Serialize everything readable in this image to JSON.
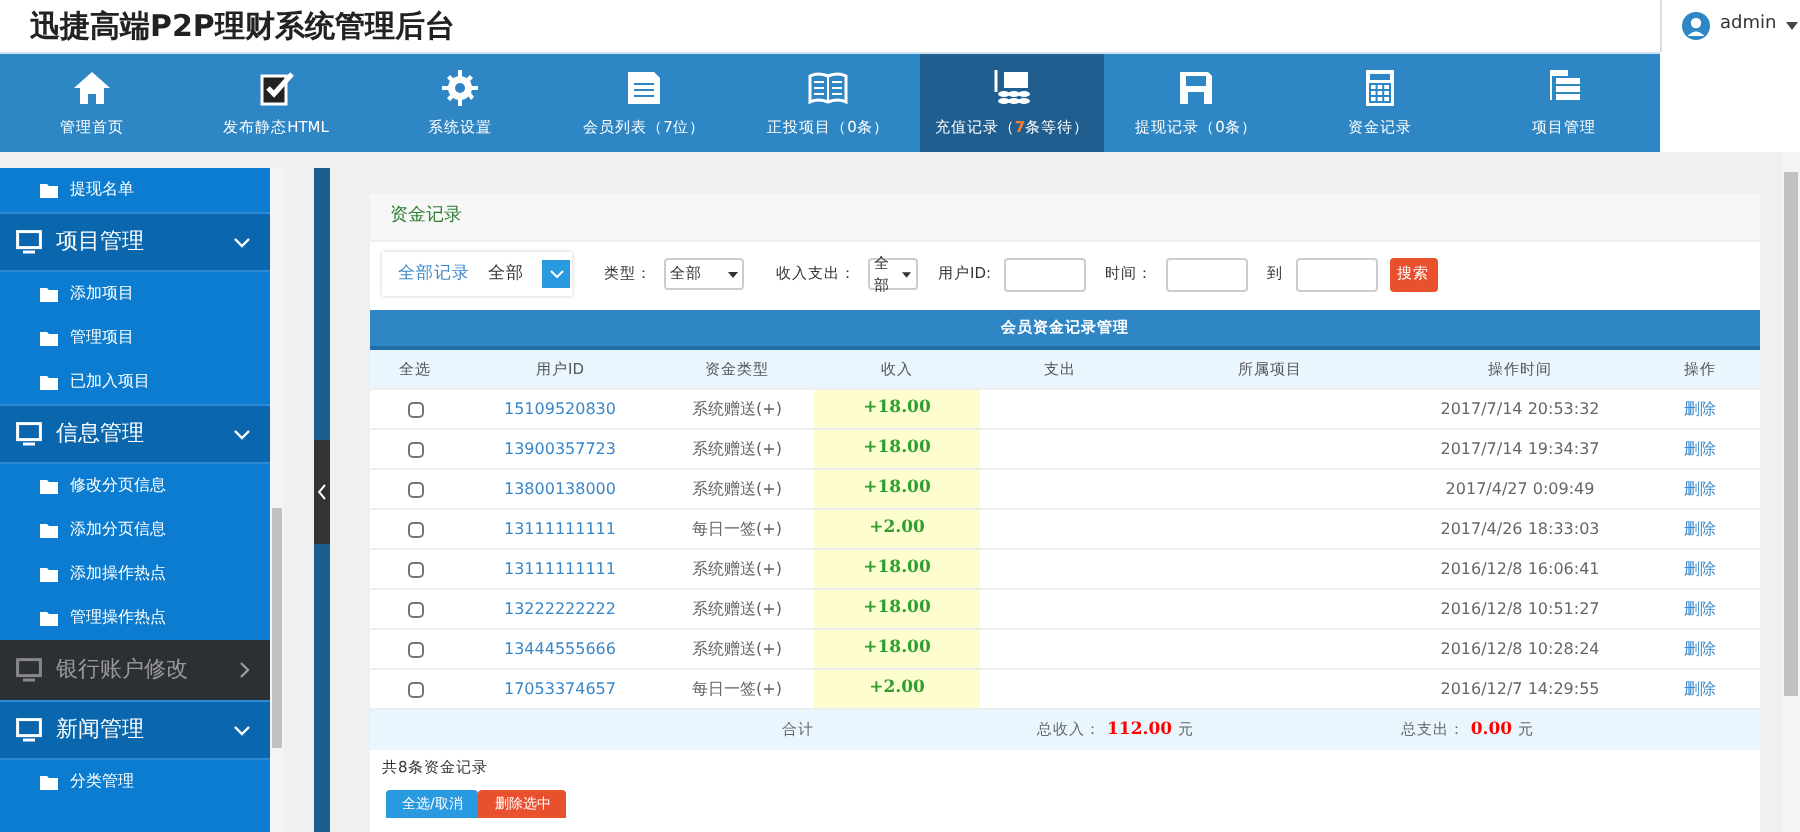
{
  "header": {
    "title": "迅捷高端P2P理财系统管理后台",
    "user": "admin"
  },
  "nav": [
    {
      "label": "管理首页",
      "selected": false
    },
    {
      "label": "发布静态HTML",
      "selected": false
    },
    {
      "label": "系统设置",
      "selected": false
    },
    {
      "label": "会员列表（7位）",
      "selected": false
    },
    {
      "label": "正投项目（0条）",
      "selected": false
    },
    {
      "label": "充值记录（",
      "count": "7",
      "suffix": "条等待）",
      "selected": true
    },
    {
      "label": "提现记录（0条）",
      "selected": false
    },
    {
      "label": "资金记录",
      "selected": false
    },
    {
      "label": "项目管理",
      "selected": false
    }
  ],
  "sidebar": [
    {
      "kind": "item",
      "label": "提现名单"
    },
    {
      "kind": "group",
      "label": "项目管理",
      "expanded": true,
      "children": [
        "添加项目",
        "管理项目",
        "已加入项目"
      ]
    },
    {
      "kind": "group",
      "label": "信息管理",
      "expanded": true,
      "children": [
        "修改分页信息",
        "添加分页信息",
        "添加操作热点",
        "管理操作热点"
      ]
    },
    {
      "kind": "group",
      "label": "银行账户修改",
      "expanded": false
    },
    {
      "kind": "group",
      "label": "新闻管理",
      "expanded": true,
      "children": [
        "分类管理"
      ]
    }
  ],
  "panel": {
    "title": "资金记录",
    "filter": {
      "scope_link": "全部记录",
      "scope_value": "全部",
      "type_label": "类型：",
      "type_value": "全部",
      "io_label": "收入支出：",
      "io_value": "全部",
      "user_label": "用户ID:",
      "time_label": "时间：",
      "to_label": "到",
      "search": "搜索"
    },
    "table": {
      "caption": "会员资金记录管理",
      "columns": [
        "全选",
        "用户ID",
        "资金类型",
        "收入",
        "支出",
        "所属项目",
        "操作时间",
        "操作"
      ],
      "rows": [
        {
          "checked": false,
          "user": "15109520830",
          "type": "系统赠送(+)",
          "income": "+18.00",
          "time": "2017/7/14 20:53:32",
          "action": "删除"
        },
        {
          "checked": false,
          "user": "13900357723",
          "type": "系统赠送(+)",
          "income": "+18.00",
          "time": "2017/7/14 19:34:37",
          "action": "删除"
        },
        {
          "checked": false,
          "user": "13800138000",
          "type": "系统赠送(+)",
          "income": "+18.00",
          "time": "2017/4/27 0:09:49",
          "action": "删除"
        },
        {
          "checked": false,
          "user": "13111111111",
          "type": "每日一签(+)",
          "income": "+2.00",
          "time": "2017/4/26 18:33:03",
          "action": "删除"
        },
        {
          "checked": false,
          "user": "13111111111",
          "type": "系统赠送(+)",
          "income": "+18.00",
          "time": "2016/12/8 16:06:41",
          "action": "删除"
        },
        {
          "checked": false,
          "user": "13222222222",
          "type": "系统赠送(+)",
          "income": "+18.00",
          "time": "2016/12/8 10:51:27",
          "action": "删除"
        },
        {
          "checked": false,
          "user": "13444555666",
          "type": "系统赠送(+)",
          "income": "+18.00",
          "time": "2016/12/8 10:28:24",
          "action": "删除"
        },
        {
          "checked": false,
          "user": "17053374657",
          "type": "每日一签(+)",
          "income": "+2.00",
          "time": "2016/12/7 14:29:55",
          "action": "删除"
        }
      ],
      "total_label": "合计",
      "income_label": "总收入：",
      "income_total": "112.00",
      "income_unit": "元",
      "expense_label": "总支出：",
      "expense_total": "0.00",
      "expense_unit": "元"
    },
    "count_text": "共8条资金记录",
    "buttons": [
      "全选/取消",
      "删除选中"
    ]
  }
}
